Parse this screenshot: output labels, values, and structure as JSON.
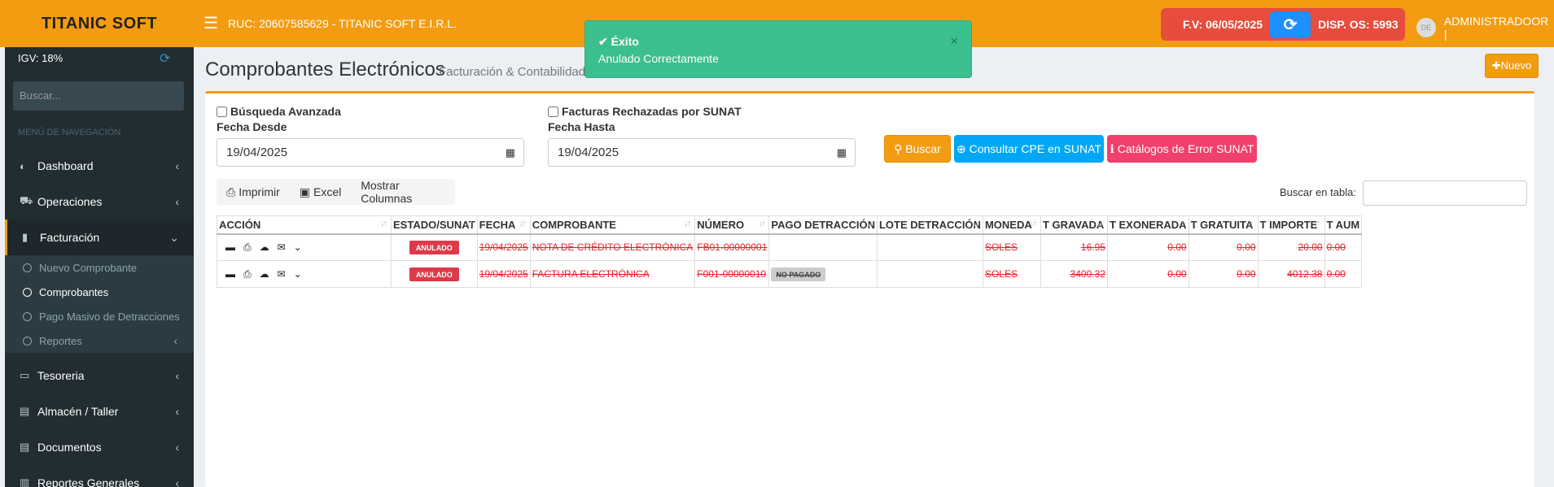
{
  "header": {
    "logo": "TITANIC SOFT",
    "ruc": "RUC: 20607585629 - TITANIC SOFT E.I.R.L.",
    "fv": "F.V: 06/05/2025",
    "disp": "DISP. OS:  5993",
    "avatar_text": "DE",
    "user": "ADMINISTRADOOR |"
  },
  "toast": {
    "title": "✔ Éxito",
    "message": "Anulado Correctamente",
    "close": "×"
  },
  "sidebar": {
    "igv": "IGV: 18%",
    "search_placeholder": "Buscar...",
    "nav_header": "MENÚ DE NAVEGACIÓN",
    "items": [
      {
        "label": "Dashboard",
        "icon": "◐"
      },
      {
        "label": "Operaciones",
        "icon": "⛟"
      },
      {
        "label": "Facturación",
        "icon": "▮"
      },
      {
        "label": "Tesoreria",
        "icon": "▭"
      },
      {
        "label": "Almacén / Taller",
        "icon": "▤"
      },
      {
        "label": "Documentos",
        "icon": "▤"
      },
      {
        "label": "Reportes Generales",
        "icon": "▥"
      }
    ],
    "sub_items": [
      {
        "label": "Nuevo Comprobante"
      },
      {
        "label": "Comprobantes"
      },
      {
        "label": "Pago Masivo de Detracciones"
      },
      {
        "label": "Reportes"
      }
    ]
  },
  "page": {
    "title": "Comprobantes Electrónicos",
    "subtitle": "Facturación & Contabilidad",
    "new_button": "✚Nuevo"
  },
  "filters": {
    "advanced_search": "Búsqueda Avanzada",
    "rejected": "Facturas Rechazadas por SUNAT",
    "date_from_label": "Fecha Desde",
    "date_from": "19/04/2025",
    "date_to_label": "Fecha Hasta",
    "date_to": "19/04/2025",
    "search_btn": "Buscar",
    "sunat_btn": "Consultar CPE en SUNAT",
    "catalog_btn": "Catálogos de Error SUNAT"
  },
  "tools": {
    "print": "Imprimir",
    "excel": "Excel",
    "columns": "Mostrar Columnas",
    "table_search_label": "Buscar en tabla:"
  },
  "table": {
    "headers": [
      "ACCIÓN",
      "ESTADO/SUNAT",
      "FECHA",
      "COMPROBANTE",
      "NÚMERO",
      "PAGO DETRACCIÓN",
      "LOTE DETRACCIÓN",
      "MONEDA",
      "T GRAVADA",
      "T EXONERADA",
      "T GRATUITA",
      "T IMPORTE",
      "T AUM"
    ],
    "rows": [
      {
        "estado": "ANULADO",
        "fecha": "19/04/2025",
        "comprobante": "NOTA DE CRÉDITO ELECTRÓNICA",
        "numero": "FB01-00000001",
        "pago": "",
        "lote": "",
        "moneda": "SOLES",
        "gravada": "16.95",
        "exonerada": "0.00",
        "gratuita": "0.00",
        "importe": "20.00",
        "aum": "0.00"
      },
      {
        "estado": "ANULADO",
        "fecha": "19/04/2025",
        "comprobante": "FACTURA ELECTRÓNICA",
        "numero": "F001-00000010",
        "pago": "NO PAGADO",
        "lote": "",
        "moneda": "SOLES",
        "gravada": "3400.32",
        "exonerada": "0.00",
        "gratuita": "0.00",
        "importe": "4012.38",
        "aum": "0.00"
      }
    ]
  },
  "colors": {
    "accent": "#f39c12",
    "danger": "#e74c3c",
    "success": "#3cbf8e",
    "info": "#00a7f7",
    "pink": "#f0406b"
  }
}
